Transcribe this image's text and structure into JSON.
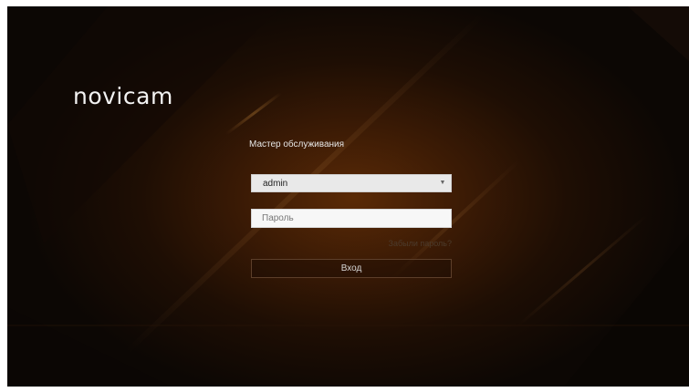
{
  "app": {
    "logo_text": "novicam"
  },
  "login": {
    "title": "Мастер обслуживания",
    "username": {
      "value": "admin",
      "dropdown_icon": "chevron-down-icon"
    },
    "password": {
      "placeholder": "Пароль",
      "value": ""
    },
    "forgot_link": "Забыли пароль?",
    "submit_label": "Вход"
  },
  "colors": {
    "background_dark": "#0c0704",
    "background_glow": "#5a2a06",
    "input_bg": "#e9e9e9",
    "button_border": "#5d3f2a",
    "link_muted": "#4c3b2c"
  }
}
